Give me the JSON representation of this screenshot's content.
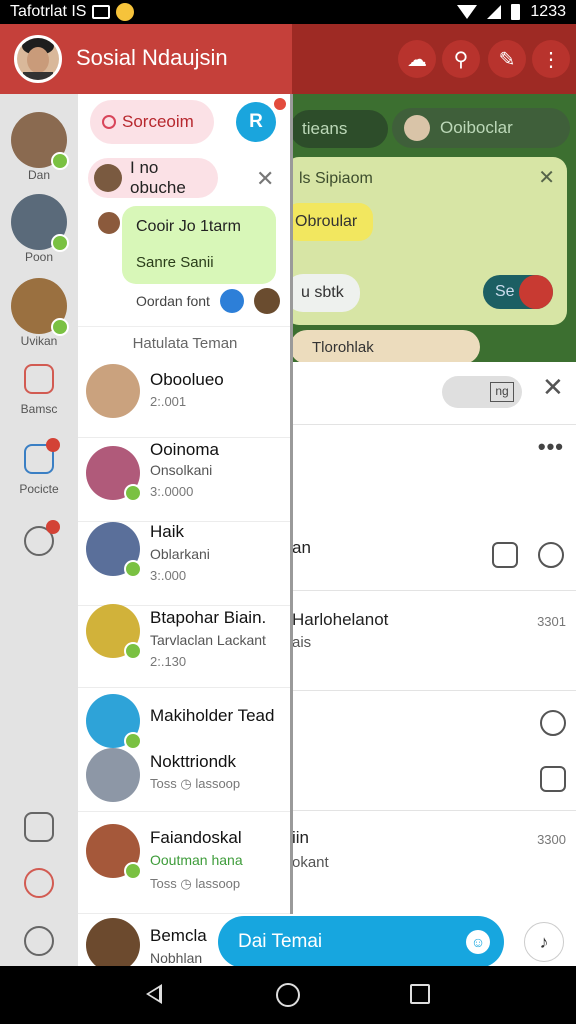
{
  "status_bar": {
    "left_text": "Tafotrlat IS",
    "time": "1233"
  },
  "app": {
    "title": "Sosial Ndaujsin"
  },
  "drawer": {
    "search_label": "Sorceoim",
    "fab_label": "R",
    "request_label": "I no obuche",
    "green_card": {
      "line1": "Cooir",
      "line1b": "Jo 1tarm",
      "line2": "Sanre Sanii"
    },
    "meta_text": "Oordan font",
    "section_header": "Hatulata Teman",
    "contacts": [
      {
        "name": "Oboolueo",
        "sub": "",
        "time": "2:.001"
      },
      {
        "name": "Ooinoma",
        "sub": "Onsolkani",
        "time": "3:.0000"
      },
      {
        "name": "Haik",
        "sub": "Oblarkani",
        "time": "3:.000"
      },
      {
        "name": "Btapohar Biain.",
        "sub": "Tarvlaclan Lackant",
        "time": "2:.130"
      },
      {
        "name": "Makiholder Tead",
        "sub": "",
        "time": ""
      },
      {
        "name": "Nokttriondk",
        "sub": "",
        "time": "Toss",
        "extra": "lassoop"
      },
      {
        "name": "Faiandoskal",
        "sub": "Ooutman hana",
        "time": "Toss",
        "extra": "lassoop"
      },
      {
        "name": "Bemcla",
        "sub": "Nobhlan",
        "time": ""
      }
    ]
  },
  "rail": {
    "items": [
      {
        "label": "Dan"
      },
      {
        "label": "Poon"
      },
      {
        "label": "Uvikan"
      },
      {
        "label": "Bamsc"
      },
      {
        "label": "Pocicte"
      }
    ]
  },
  "background": {
    "chip1": "tieans",
    "chip2": "Ooiboclar",
    "card_title": "ls Sipiaom",
    "bubble1": "Obroular",
    "bubble2": "u sbtk",
    "pill_label": "Se",
    "strip": "Tlorohlak",
    "search_icon_text": "ng",
    "rows": [
      {
        "text": "an"
      },
      {
        "text": "Harlohelanot",
        "time": "3301",
        "sub": "ais"
      },
      {
        "text": "iin",
        "time": "3300",
        "sub": "okant"
      }
    ]
  },
  "chat_bar": {
    "label": "Dai Temai"
  },
  "colors": {
    "header_red": "#c5403a",
    "accent_blue": "#17a6df",
    "online_green": "#7ac142"
  }
}
